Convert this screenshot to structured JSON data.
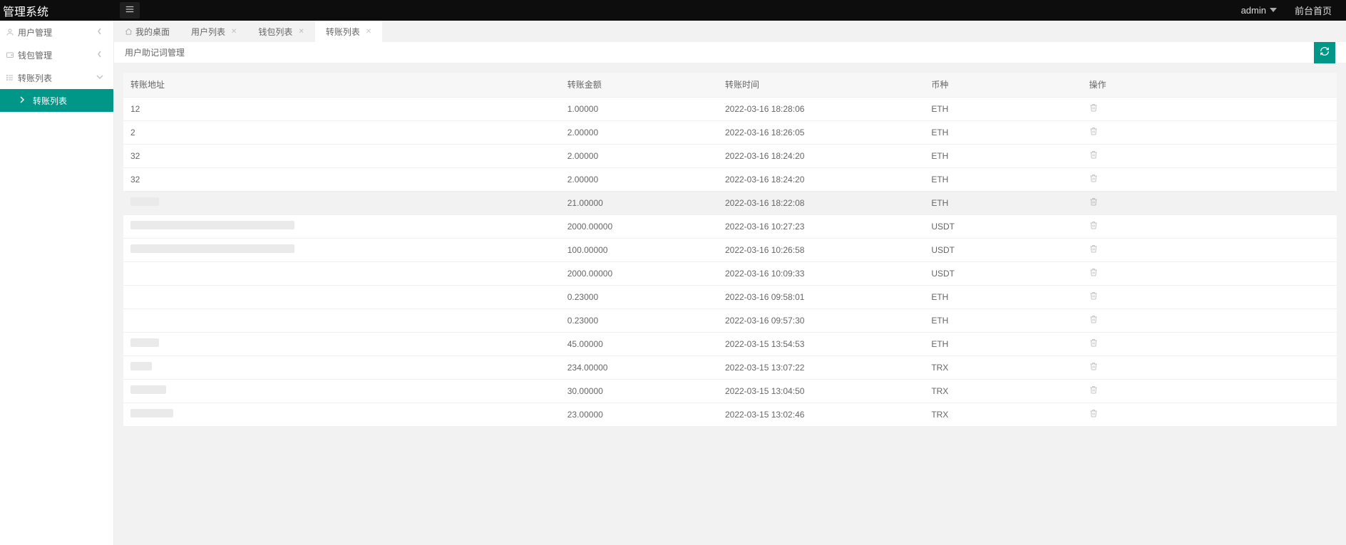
{
  "topbar": {
    "title": "管理系统",
    "user": "admin",
    "front_link": "前台首页"
  },
  "sidebar": {
    "items": [
      {
        "label": "用户管理",
        "expanded": false
      },
      {
        "label": "钱包管理",
        "expanded": false
      },
      {
        "label": "转账列表",
        "expanded": true,
        "children": [
          {
            "label": "转账列表",
            "active": true
          }
        ]
      }
    ]
  },
  "tabs": [
    {
      "label": "我的桌面",
      "closable": false,
      "home": true
    },
    {
      "label": "用户列表",
      "closable": true
    },
    {
      "label": "钱包列表",
      "closable": true
    },
    {
      "label": "转账列表",
      "closable": true,
      "active": true
    }
  ],
  "panel": {
    "title": "用户助记词管理"
  },
  "table": {
    "headers": {
      "addr": "转账地址",
      "amount": "转账金额",
      "time": "转账时间",
      "coin": "币种",
      "op": "操作"
    },
    "rows": [
      {
        "addr": "12",
        "amount": "1.00000",
        "time": "2022-03-16 18:28:06",
        "coin": "ETH"
      },
      {
        "addr": "2",
        "amount": "2.00000",
        "time": "2022-03-16 18:26:05",
        "coin": "ETH"
      },
      {
        "addr": "32",
        "amount": "2.00000",
        "time": "2022-03-16 18:24:20",
        "coin": "ETH"
      },
      {
        "addr": "32",
        "amount": "2.00000",
        "time": "2022-03-16 18:24:20",
        "coin": "ETH"
      },
      {
        "addr": "",
        "redact_w": 40,
        "amount": "21.00000",
        "time": "2022-03-16 18:22:08",
        "coin": "ETH",
        "selected": true
      },
      {
        "addr": "",
        "redact_w": 230,
        "amount": "2000.00000",
        "time": "2022-03-16 10:27:23",
        "coin": "USDT"
      },
      {
        "addr": "",
        "redact_w": 230,
        "amount": "100.00000",
        "time": "2022-03-16 10:26:58",
        "coin": "USDT"
      },
      {
        "addr": "",
        "redact_w": 0,
        "amount": "2000.00000",
        "time": "2022-03-16 10:09:33",
        "coin": "USDT"
      },
      {
        "addr": "",
        "redact_w": 0,
        "amount": "0.23000",
        "time": "2022-03-16 09:58:01",
        "coin": "ETH"
      },
      {
        "addr": "",
        "redact_w": 0,
        "amount": "0.23000",
        "time": "2022-03-16 09:57:30",
        "coin": "ETH"
      },
      {
        "addr": "",
        "redact_w": 40,
        "amount": "45.00000",
        "time": "2022-03-15 13:54:53",
        "coin": "ETH"
      },
      {
        "addr": "",
        "redact_w": 30,
        "amount": "234.00000",
        "time": "2022-03-15 13:07:22",
        "coin": "TRX"
      },
      {
        "addr": "",
        "redact_w": 50,
        "amount": "30.00000",
        "time": "2022-03-15 13:04:50",
        "coin": "TRX"
      },
      {
        "addr": "",
        "redact_w": 60,
        "amount": "23.00000",
        "time": "2022-03-15 13:02:46",
        "coin": "TRX"
      }
    ]
  }
}
